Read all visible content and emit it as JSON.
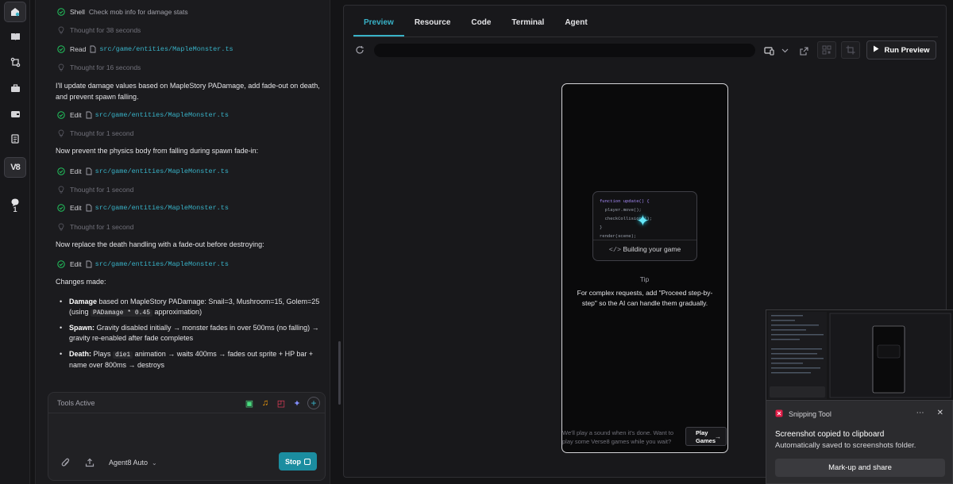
{
  "chat": {
    "steps": [
      {
        "kind": "done",
        "verb": "Shell",
        "text": "Check mob info for damage stats"
      },
      {
        "kind": "thought",
        "text": "Thought for 38 seconds"
      },
      {
        "kind": "done",
        "verb": "Read",
        "path": "src/game/entities/MapleMonster.ts"
      },
      {
        "kind": "thought",
        "text": "Thought for 16 seconds"
      },
      {
        "kind": "msg",
        "text": "I'll update damage values based on MapleStory PADamage, add fade-out on death, and prevent spawn falling."
      },
      {
        "kind": "done",
        "verb": "Edit",
        "path": "src/game/entities/MapleMonster.ts"
      },
      {
        "kind": "thought",
        "text": "Thought for 1 second"
      },
      {
        "kind": "msg",
        "text": "Now prevent the physics body from falling during spawn fade-in:"
      },
      {
        "kind": "done",
        "verb": "Edit",
        "path": "src/game/entities/MapleMonster.ts"
      },
      {
        "kind": "thought",
        "text": "Thought for 1 second"
      },
      {
        "kind": "done",
        "verb": "Edit",
        "path": "src/game/entities/MapleMonster.ts"
      },
      {
        "kind": "thought",
        "text": "Thought for 1 second"
      },
      {
        "kind": "msg",
        "text": "Now replace the death handling with a fade-out before destroying:"
      },
      {
        "kind": "done",
        "verb": "Edit",
        "path": "src/game/entities/MapleMonster.ts"
      },
      {
        "kind": "msg",
        "text": "Changes made:"
      }
    ],
    "bullets": {
      "damage": {
        "title": "Damage",
        "pre": " based on MapleStory PADamage: Snail=3, Mushroom=15, Golem=25 (using ",
        "code": "PADamage * 0.45",
        "post": " approximation)"
      },
      "spawn": {
        "title": "Spawn:",
        "text": " Gravity disabled initially → monster fades in over 500ms (no falling) → gravity re-enabled after fade completes"
      },
      "death": {
        "title": "Death:",
        "pre": " Plays ",
        "code": "die1",
        "post": " animation → waits 400ms → fades out sprite + HP bar + name over 800ms → destroys"
      }
    }
  },
  "rail": {
    "badge_count": "1",
    "logo_text": "V8"
  },
  "composer": {
    "tools_label": "Tools Active",
    "model": "Agent8 Auto",
    "stop_label": "Stop"
  },
  "preview": {
    "tabs": [
      "Preview",
      "Resource",
      "Code",
      "Terminal",
      "Agent"
    ],
    "run_label": "Run Preview",
    "card_code": [
      "function update() {",
      "  player.move();",
      "  checkCollisions();",
      "}",
      "render(scene);"
    ],
    "card_label": "Building your game",
    "tip_title": "Tip",
    "tip_body": "For complex requests, add \"Proceed step-by-step\" so the AI can handle them gradually.",
    "footer_text": "We'll play a sound when it's done. Want to play some Verse8 games while you wait?",
    "play_label_1": "Play",
    "play_label_2": "Games"
  },
  "toast": {
    "app": "Snipping Tool",
    "title": "Screenshot copied to clipboard",
    "subtitle": "Automatically saved to screenshots folder.",
    "button": "Mark-up and share"
  },
  "colors": {
    "accent": "#38b2c7",
    "stop": "#1b8da0",
    "check": "#22c55e"
  }
}
